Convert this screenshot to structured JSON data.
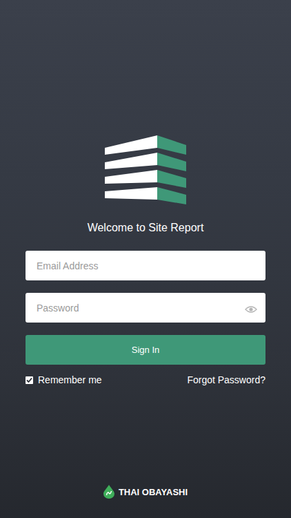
{
  "app": {
    "title": "Welcome to Site Report"
  },
  "form": {
    "email": {
      "placeholder": "Email Address"
    },
    "password": {
      "placeholder": "Password"
    },
    "sign_in": "Sign In",
    "remember": {
      "label": "Remember me",
      "checked": true
    },
    "forgot": "Forgot Password?"
  },
  "footer": {
    "brand": "THAI OBAYASHI"
  }
}
